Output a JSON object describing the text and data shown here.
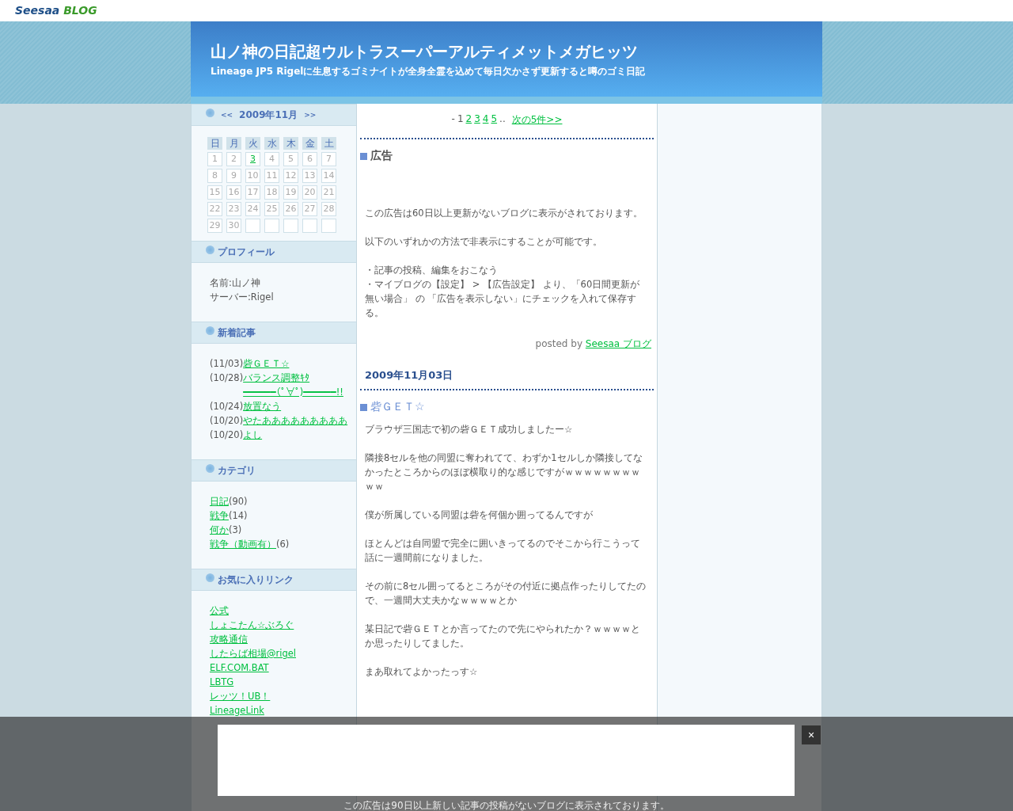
{
  "topbar": {
    "logo": "Seesaa",
    "logo_suffix": "BLOG"
  },
  "header": {
    "title": "山ノ神の日記超ウルトラスーパーアルティメットメガヒッツ",
    "subtitle": "Lineage JP5 Rigelに生息するゴミナイトが全身全霊を込めて毎日欠かさず更新すると噂のゴミ日記"
  },
  "calendar": {
    "prev": "<<",
    "month": "2009年11月",
    "next": ">>",
    "weekdays": [
      "日",
      "月",
      "火",
      "水",
      "木",
      "金",
      "土"
    ],
    "days": [
      {
        "label": "1",
        "linked": false
      },
      {
        "label": "2",
        "linked": false
      },
      {
        "label": "3",
        "linked": true
      },
      {
        "label": "4",
        "linked": false
      },
      {
        "label": "5",
        "linked": false
      },
      {
        "label": "6",
        "linked": false
      },
      {
        "label": "7",
        "linked": false
      },
      {
        "label": "8",
        "linked": false
      },
      {
        "label": "9",
        "linked": false
      },
      {
        "label": "10",
        "linked": false
      },
      {
        "label": "11",
        "linked": false
      },
      {
        "label": "12",
        "linked": false
      },
      {
        "label": "13",
        "linked": false
      },
      {
        "label": "14",
        "linked": false
      },
      {
        "label": "15",
        "linked": false
      },
      {
        "label": "16",
        "linked": false
      },
      {
        "label": "17",
        "linked": false
      },
      {
        "label": "18",
        "linked": false
      },
      {
        "label": "19",
        "linked": false
      },
      {
        "label": "20",
        "linked": false
      },
      {
        "label": "21",
        "linked": false
      },
      {
        "label": "22",
        "linked": false
      },
      {
        "label": "23",
        "linked": false
      },
      {
        "label": "24",
        "linked": false
      },
      {
        "label": "25",
        "linked": false
      },
      {
        "label": "26",
        "linked": false
      },
      {
        "label": "27",
        "linked": false
      },
      {
        "label": "28",
        "linked": false
      },
      {
        "label": "29",
        "linked": false
      },
      {
        "label": "30",
        "linked": false
      }
    ]
  },
  "profile": {
    "title": "プロフィール",
    "lines": [
      "名前:山ノ神",
      "サーバー:Rigel"
    ]
  },
  "recent": {
    "title": "新着記事",
    "items": [
      {
        "date": "(11/03)",
        "title": "砦ＧＥＴ☆"
      },
      {
        "date": "(10/28)",
        "title": "バランス調整ｷﾀ━━━━━━(ﾟ∀ﾟ)━━━━━━!!"
      },
      {
        "date": "(10/24)",
        "title": "放置なう"
      },
      {
        "date": "(10/20)",
        "title": "やたあああああああああ"
      },
      {
        "date": "(10/20)",
        "title": "よし"
      }
    ]
  },
  "categories": {
    "title": "カテゴリ",
    "items": [
      {
        "name": "日記",
        "count": "(90)"
      },
      {
        "name": "戦争",
        "count": "(14)"
      },
      {
        "name": "何か",
        "count": "(3)"
      },
      {
        "name": "戦争（動画有）",
        "count": "(6)"
      }
    ]
  },
  "links": {
    "title": "お気に入りリンク",
    "items": [
      "公式",
      "しょこたん☆ぶろぐ",
      "攻略通信",
      "したらば相場@rigel",
      "ELF.COM.BAT",
      "LBTG",
      "レッツ！UB！",
      "LineageLink"
    ]
  },
  "pager": {
    "prefix": "-",
    "pages": [
      {
        "label": "1",
        "current": true
      },
      {
        "label": "2",
        "current": false
      },
      {
        "label": "3",
        "current": false
      },
      {
        "label": "4",
        "current": false
      },
      {
        "label": "5",
        "current": false
      }
    ],
    "ellipsis": "..",
    "next": "次の5件>>"
  },
  "ad_post": {
    "title": "広告",
    "paragraphs": [
      [
        "この広告は60日以上更新がないブログに表示がされております。"
      ],
      [
        "以下のいずれかの方法で非表示にすることが可能です。"
      ],
      [
        "・記事の投稿、編集をおこなう",
        "・マイブログの【設定】 > 【広告設定】 より、「60日間更新が無い場合」 の 「広告を表示しない」にチェックを入れて保存する。"
      ]
    ],
    "posted_by": "posted by",
    "posted_link": "Seesaa ブログ"
  },
  "post": {
    "date": "2009年11月03日",
    "title": "砦ＧＥＴ☆",
    "paragraphs": [
      "ブラウザ三国志で初の砦ＧＥＴ成功しましたー☆",
      "隣接8セルを他の同盟に奪われてて、わずか1セルしか隣接してなかったところからのほぼ横取り的な感じですがｗｗｗｗｗｗｗｗｗｗ",
      "僕が所属している同盟は砦を何個か囲ってるんですが",
      "ほとんどは自同盟で完全に囲いきってるのでそこから行こうって話に一週間前になりました。",
      "その前に8セル囲ってるところがその付近に拠点作ったりしてたので、一週間大丈夫かなｗｗｗｗとか",
      "某日記で砦ＧＥＴとか言ってたので先にやられたか？ｗｗｗｗとか思ったりしてました。",
      "まあ取れてよかったっす☆"
    ]
  },
  "overlay": {
    "close": "×",
    "notice": "この広告は90日以上新しい記事の投稿がないブログに表示されております。"
  }
}
